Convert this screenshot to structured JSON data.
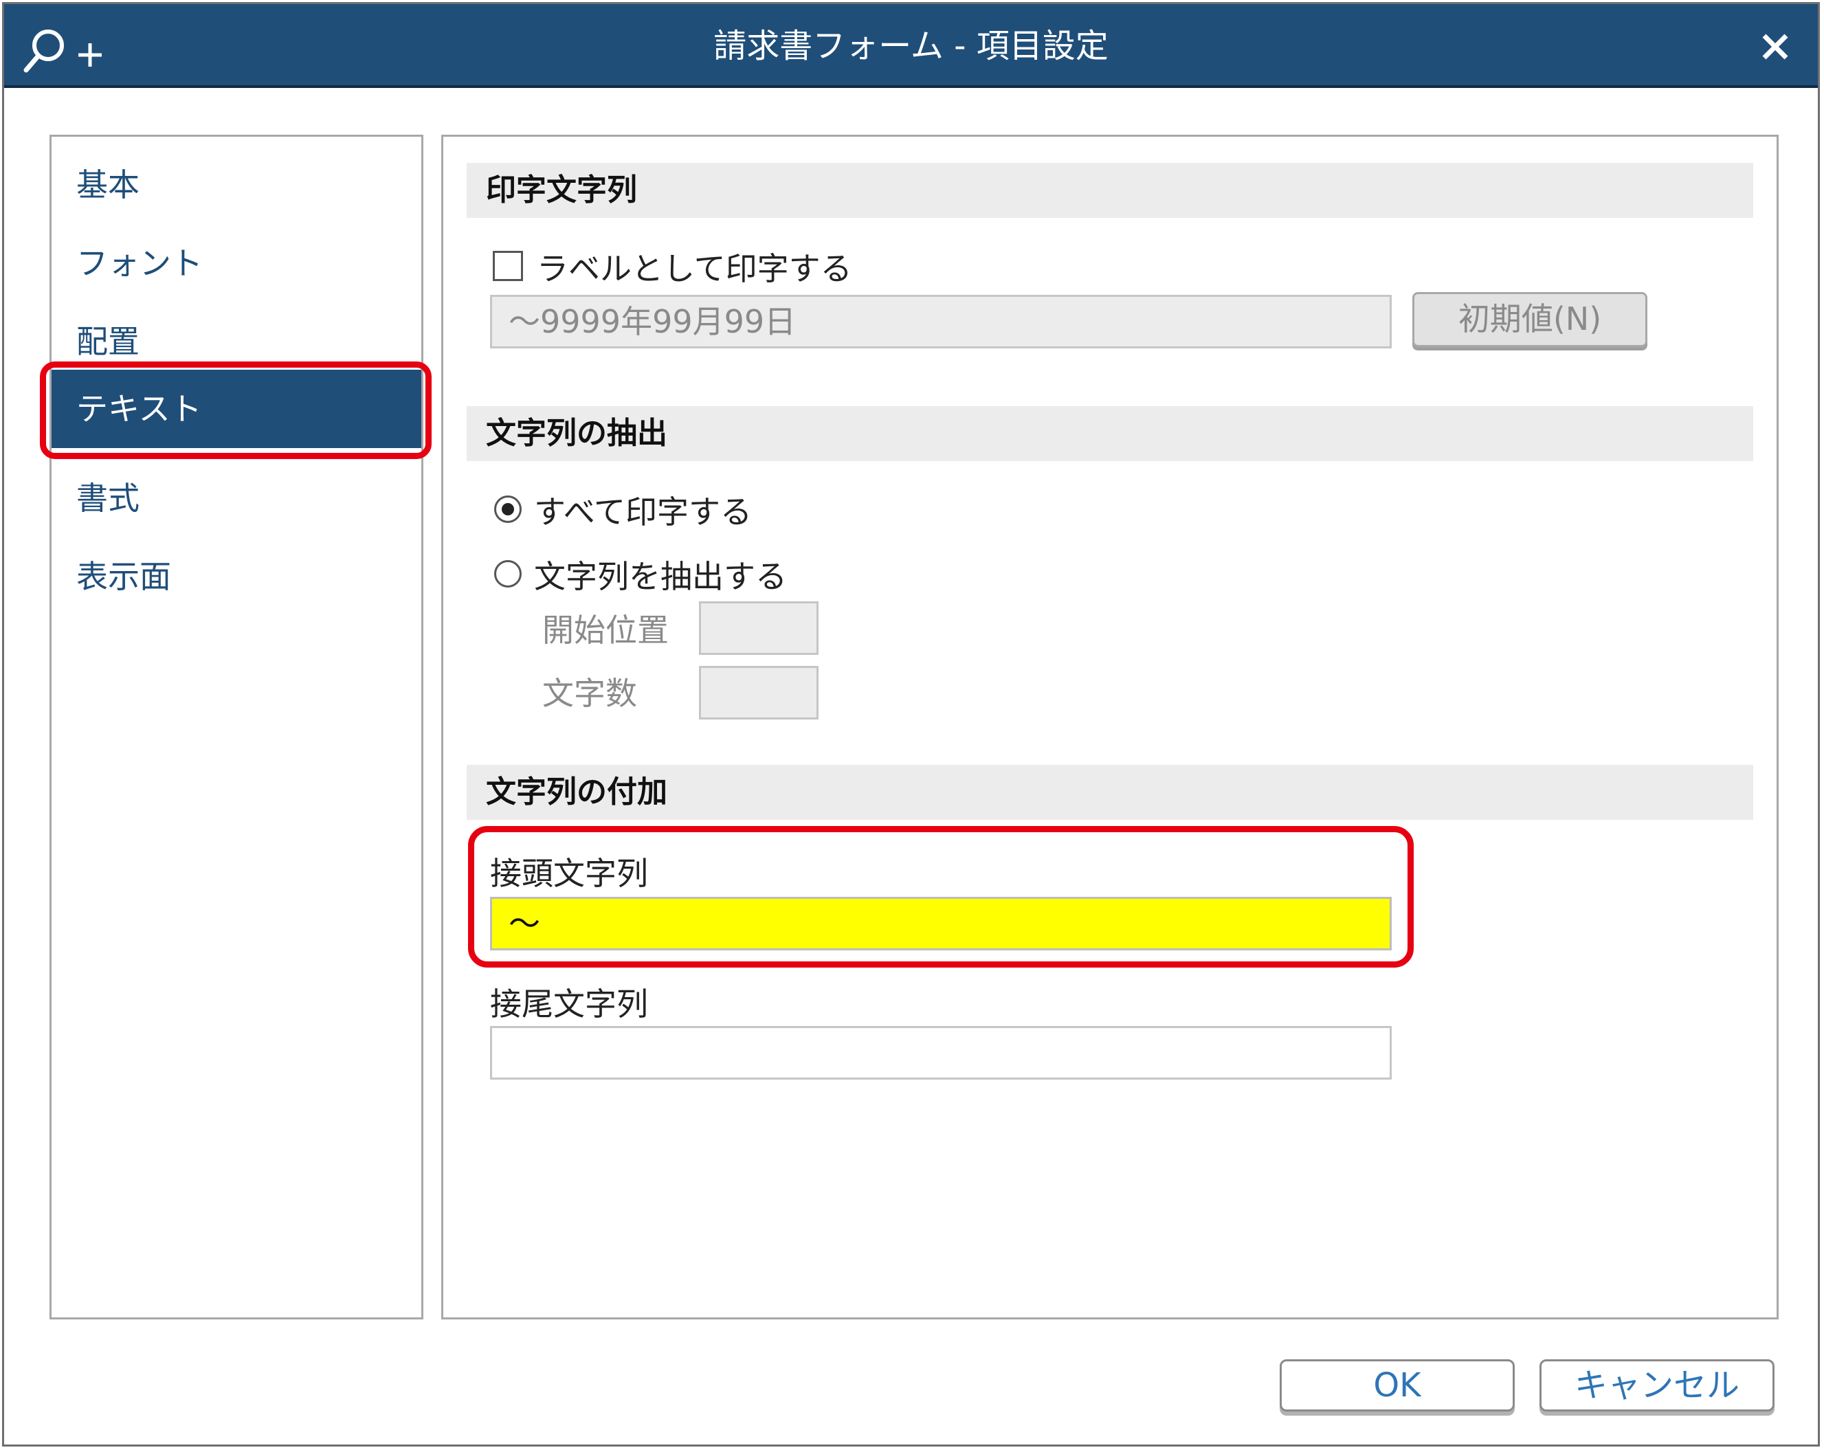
{
  "window": {
    "title": "請求書フォーム - 項目設定",
    "title_bg": "#1f4e79"
  },
  "sidebar": {
    "items": [
      {
        "label": "基本"
      },
      {
        "label": "フォント"
      },
      {
        "label": "配置"
      },
      {
        "label": "テキスト",
        "selected": true
      },
      {
        "label": "書式"
      },
      {
        "label": "表示面"
      }
    ]
  },
  "print_string": {
    "header": "印字文字列",
    "label_checkbox": "ラベルとして印字する",
    "label_checked": false,
    "value": "〜9999年99月99日",
    "default_button": "初期値(N)"
  },
  "extract": {
    "header": "文字列の抽出",
    "option_all": "すべて印字する",
    "option_extract": "文字列を抽出する",
    "selected": "all",
    "start_label": "開始位置",
    "start_value": "",
    "count_label": "文字数",
    "count_value": ""
  },
  "append": {
    "header": "文字列の付加",
    "prefix_label": "接頭文字列",
    "prefix_value": "〜",
    "suffix_label": "接尾文字列",
    "suffix_value": ""
  },
  "footer": {
    "ok": "OK",
    "cancel": "キャンセル"
  },
  "colors": {
    "accent": "#1f4e79",
    "highlight": "#e60012",
    "field_highlight": "#ffff00",
    "button_text": "#2e75b6"
  }
}
